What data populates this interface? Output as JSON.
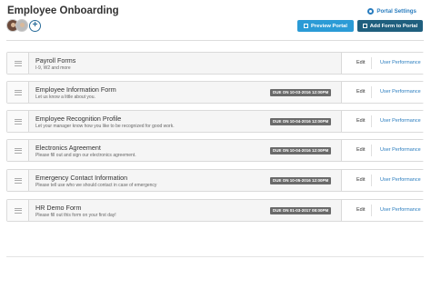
{
  "header": {
    "title": "Employee Onboarding",
    "portal_settings_label": "Portal Settings",
    "preview_portal_label": "Preview Portal",
    "add_form_label": "Add Form to Portal"
  },
  "colors": {
    "accent": "#2b9bd6",
    "dark_accent": "#1f5f7e",
    "link": "#2a7dbf",
    "badge": "#6a6a6a"
  },
  "forms": [
    {
      "name": "Payroll Forms",
      "description": "I-9, W2 and more",
      "due": "",
      "edit": "Edit",
      "performance": "User Performance"
    },
    {
      "name": "Employee Information Form",
      "description": "Let us know a little about you.",
      "due": "DUE ON 10-03-2016 12:00PM",
      "edit": "Edit",
      "performance": "User Performance"
    },
    {
      "name": "Employee Recognition Profile",
      "description": "Let your manager know how you like to be recognized for good work.",
      "due": "DUE ON 10-04-2016 12:00PM",
      "edit": "Edit",
      "performance": "User Performance"
    },
    {
      "name": "Electronics Agreement",
      "description": "Please fill out and sign our electronics agreement.",
      "due": "DUE ON 10-04-2016 12:00PM",
      "edit": "Edit",
      "performance": "User Performance"
    },
    {
      "name": "Emergency Contact Information",
      "description": "Please tell use who we should contact in case of emergency",
      "due": "DUE ON 10-05-2016 12:00PM",
      "edit": "Edit",
      "performance": "User Performance"
    },
    {
      "name": "HR Demo Form",
      "description": "Please fill out this form on your first day!",
      "due": "DUE ON 01-03-2017 08:00PM",
      "edit": "Edit",
      "performance": "User Performance"
    }
  ]
}
